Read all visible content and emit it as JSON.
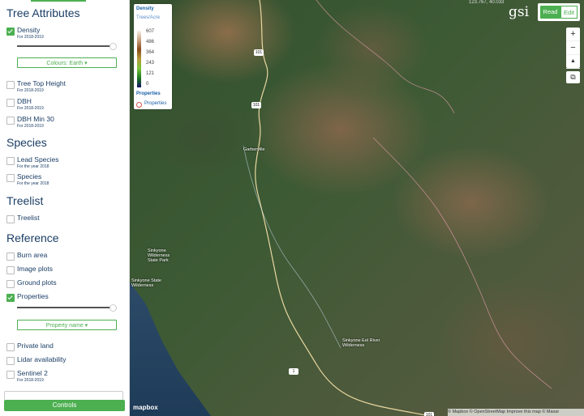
{
  "sidebar": {
    "sections": {
      "tree_attributes": "Tree Attributes",
      "species": "Species",
      "treelist": "Treelist",
      "reference": "Reference"
    },
    "density": {
      "label": "Density",
      "sub": "For 2018-2019",
      "checked": true
    },
    "colours_button": "Colours: Earth",
    "tree_top_height": {
      "label": "Tree Top Height",
      "sub": "For 2018-2019"
    },
    "dbh": {
      "label": "DBH",
      "sub": "For 2018-2019"
    },
    "dbh_min30": {
      "label": "DBH Min 30",
      "sub": "For 2018-2019"
    },
    "lead_species": {
      "label": "Lead Species",
      "sub": "For the year 2018"
    },
    "species": {
      "label": "Species",
      "sub": "For the year 2018"
    },
    "treelist": {
      "label": "Treelist"
    },
    "burn_area": {
      "label": "Burn area"
    },
    "image_plots": {
      "label": "Image plots"
    },
    "ground_plots": {
      "label": "Ground plots"
    },
    "properties": {
      "label": "Properties",
      "checked": true
    },
    "property_name_button": "Property name",
    "private_land": {
      "label": "Private land"
    },
    "lidar": {
      "label": "Lidar availability"
    },
    "sentinel": {
      "label": "Sentinel 2",
      "sub": "For 2018-2019"
    },
    "controls_button": "Controls"
  },
  "legend": {
    "title": "Density",
    "unit": "Trees/Acre",
    "ticks": [
      "607",
      "486",
      "364",
      "243",
      "121",
      "0"
    ],
    "properties_title": "Properties",
    "properties_item": "Properties"
  },
  "map": {
    "coords": "123.767, 40.033",
    "read_button": "Read",
    "edit_button": "Edit",
    "logo": "gsi",
    "zoom_in": "+",
    "zoom_out": "−",
    "compass": "▲",
    "layers_icon": "⧉",
    "shields": [
      "101",
      "101",
      "101",
      "1",
      "101"
    ],
    "places": [
      "Garberville",
      "Sinkyone Wilderness State Park",
      "Sinkyone State Wilderness",
      "Sinkyone Eel River Wilderness"
    ],
    "mapbox_logo": "mapbox",
    "attribution": "© Mapbox © OpenStreetMap Improve this map © Maxar"
  },
  "colors": {
    "accent": "#4caf50",
    "text": "#1b3e66"
  }
}
